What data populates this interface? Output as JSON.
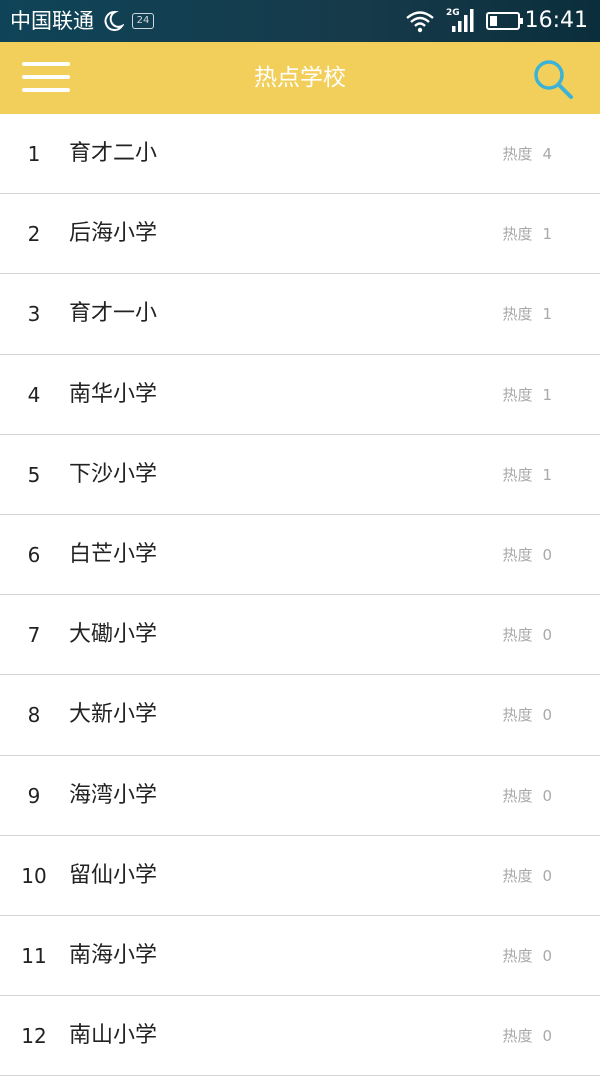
{
  "status_bar": {
    "carrier": "中国联通",
    "notification_badge": "24",
    "network_type": "2G",
    "time": "16:41"
  },
  "app_bar": {
    "title": "热点学校",
    "accent_color": "#f2cf5b",
    "search_icon_color": "#3bb3d6"
  },
  "heat_label": "热度",
  "schools": [
    {
      "rank": "1",
      "name": "育才二小",
      "heat": "4"
    },
    {
      "rank": "2",
      "name": "后海小学",
      "heat": "1"
    },
    {
      "rank": "3",
      "name": "育才一小",
      "heat": "1"
    },
    {
      "rank": "4",
      "name": "南华小学",
      "heat": "1"
    },
    {
      "rank": "5",
      "name": "下沙小学",
      "heat": "1"
    },
    {
      "rank": "6",
      "name": "白芒小学",
      "heat": "0"
    },
    {
      "rank": "7",
      "name": "大磡小学",
      "heat": "0"
    },
    {
      "rank": "8",
      "name": "大新小学",
      "heat": "0"
    },
    {
      "rank": "9",
      "name": "海湾小学",
      "heat": "0"
    },
    {
      "rank": "10",
      "name": "留仙小学",
      "heat": "0"
    },
    {
      "rank": "11",
      "name": "南海小学",
      "heat": "0"
    },
    {
      "rank": "12",
      "name": "南山小学",
      "heat": "0"
    }
  ]
}
